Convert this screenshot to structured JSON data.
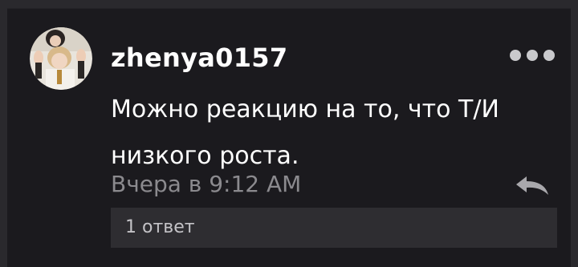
{
  "comment": {
    "username": "zhenya0157",
    "text": "Можно реакцию на то, что Т/И низкого роста.",
    "timestamp": "Вчера в 9:12 AM",
    "replies_label": "1 ответ"
  },
  "icons": {
    "more": "more-horizontal-icon",
    "reply": "reply-arrow-icon"
  },
  "colors": {
    "background": "#1b1a1e",
    "username": "#ffffff",
    "timestamp": "#8b8a8e",
    "replies_bar": "#2e2d31"
  }
}
